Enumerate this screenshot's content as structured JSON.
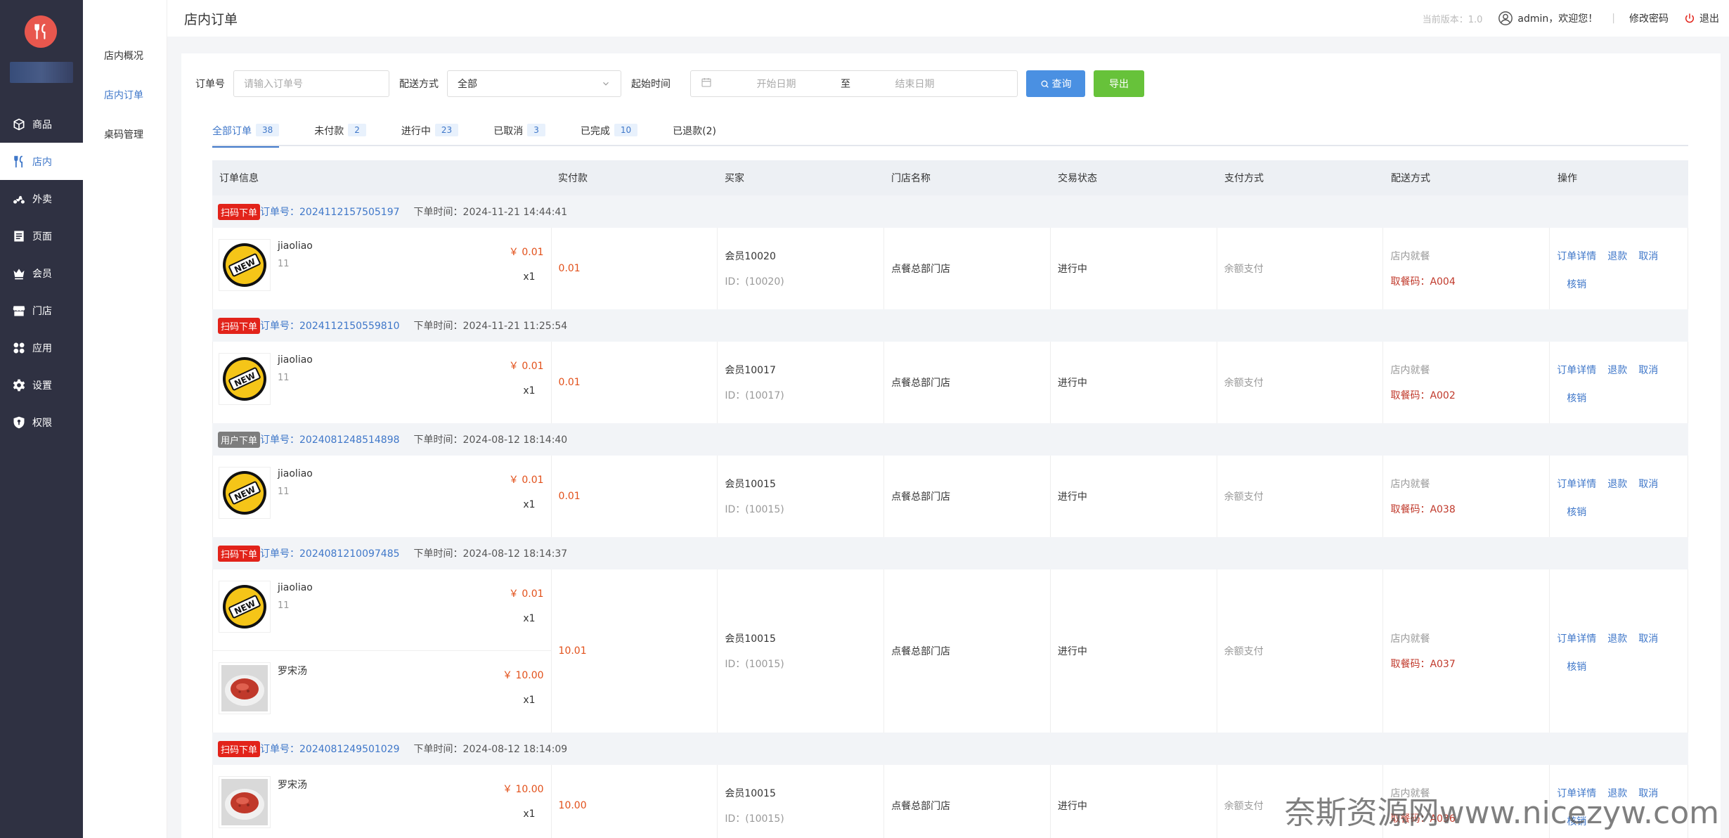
{
  "sidebar": {
    "items": [
      {
        "label": "商品",
        "icon": "box-icon"
      },
      {
        "label": "店内",
        "icon": "cutlery-icon"
      },
      {
        "label": "外卖",
        "icon": "scooter-icon"
      },
      {
        "label": "页面",
        "icon": "page-icon"
      },
      {
        "label": "会员",
        "icon": "crown-icon"
      },
      {
        "label": "门店",
        "icon": "store-icon"
      },
      {
        "label": "应用",
        "icon": "apps-icon"
      },
      {
        "label": "设置",
        "icon": "gear-icon"
      },
      {
        "label": "权限",
        "icon": "shield-icon"
      }
    ],
    "active_index": 1
  },
  "subnav": {
    "items": [
      "店内概况",
      "店内订单",
      "桌码管理"
    ],
    "active_index": 1
  },
  "header": {
    "title": "店内订单",
    "version": "当前版本：1.0",
    "welcome": "admin，欢迎您！",
    "sep": "|",
    "change_password": "修改密码",
    "logout": "退出"
  },
  "filters": {
    "order_no_label": "订单号",
    "order_no_placeholder": "请输入订单号",
    "delivery_label": "配送方式",
    "delivery_value": "全部",
    "start_time_label": "起始时间",
    "start_placeholder": "开始日期",
    "range_sep": "至",
    "end_placeholder": "结束日期",
    "query_label": "查询",
    "export_label": "导出"
  },
  "tabs": [
    {
      "label": "全部订单",
      "count": "38"
    },
    {
      "label": "未付款",
      "count": "2"
    },
    {
      "label": "进行中",
      "count": "23"
    },
    {
      "label": "已取消",
      "count": "3"
    },
    {
      "label": "已完成",
      "count": "10"
    },
    {
      "label": "已退款(2)",
      "count": ""
    }
  ],
  "table": {
    "columns": [
      "订单信息",
      "实付款",
      "买家",
      "门店名称",
      "交易状态",
      "支付方式",
      "配送方式",
      "操作"
    ],
    "orders": [
      {
        "tag": "扫码下单",
        "tag_color": "#e2231a",
        "order_no": "订单号：2024112157505197",
        "time": "下单时间：2024-11-21 14:44:41",
        "products": [
          {
            "name": "jiaoliao",
            "spec": "11",
            "price": "￥ 0.01",
            "qty": "x1",
            "thumb": "new-badge"
          }
        ],
        "paid": "0.01",
        "buyer": "会员10020",
        "buyer_id": "ID：(10020)",
        "store": "点餐总部门店",
        "status": "进行中",
        "pay_method": "余额支付",
        "delivery": "店内就餐",
        "pickup": "取餐码：A004",
        "ops": [
          "订单详情",
          "退款",
          "取消",
          "核销"
        ]
      },
      {
        "tag": "扫码下单",
        "tag_color": "#e2231a",
        "order_no": "订单号：2024112150559810",
        "time": "下单时间：2024-11-21 11:25:54",
        "products": [
          {
            "name": "jiaoliao",
            "spec": "11",
            "price": "￥ 0.01",
            "qty": "x1",
            "thumb": "new-badge"
          }
        ],
        "paid": "0.01",
        "buyer": "会员10017",
        "buyer_id": "ID：(10017)",
        "store": "点餐总部门店",
        "status": "进行中",
        "pay_method": "余额支付",
        "delivery": "店内就餐",
        "pickup": "取餐码：A002",
        "ops": [
          "订单详情",
          "退款",
          "取消",
          "核销"
        ]
      },
      {
        "tag": "用户下单",
        "tag_color": "#7d7d7d",
        "order_no": "订单号：2024081248514898",
        "time": "下单时间：2024-08-12 18:14:40",
        "products": [
          {
            "name": "jiaoliao",
            "spec": "11",
            "price": "￥ 0.01",
            "qty": "x1",
            "thumb": "new-badge"
          }
        ],
        "paid": "0.01",
        "buyer": "会员10015",
        "buyer_id": "ID：(10015)",
        "store": "点餐总部门店",
        "status": "进行中",
        "pay_method": "余额支付",
        "delivery": "店内就餐",
        "pickup": "取餐码：A038",
        "ops": [
          "订单详情",
          "退款",
          "取消",
          "核销"
        ]
      },
      {
        "tag": "扫码下单",
        "tag_color": "#e2231a",
        "order_no": "订单号：2024081210097485",
        "time": "下单时间：2024-08-12 18:14:37",
        "products": [
          {
            "name": "jiaoliao",
            "spec": "11",
            "price": "￥ 0.01",
            "qty": "x1",
            "thumb": "new-badge"
          },
          {
            "name": "罗宋汤",
            "spec": "",
            "price": "￥ 10.00",
            "qty": "x1",
            "thumb": "soup"
          }
        ],
        "paid": "10.01",
        "buyer": "会员10015",
        "buyer_id": "ID：(10015)",
        "store": "点餐总部门店",
        "status": "进行中",
        "pay_method": "余额支付",
        "delivery": "店内就餐",
        "pickup": "取餐码：A037",
        "ops": [
          "订单详情",
          "退款",
          "取消",
          "核销"
        ]
      },
      {
        "tag": "扫码下单",
        "tag_color": "#e2231a",
        "order_no": "订单号：2024081249501029",
        "time": "下单时间：2024-08-12 18:14:09",
        "products": [
          {
            "name": "罗宋汤",
            "spec": "",
            "price": "￥ 10.00",
            "qty": "x1",
            "thumb": "soup"
          }
        ],
        "paid": "10.00",
        "buyer": "会员10015",
        "buyer_id": "ID：(10015)",
        "store": "点餐总部门店",
        "status": "进行中",
        "pay_method": "余额支付",
        "delivery": "店内就餐",
        "pickup": "取餐码：A036",
        "ops": [
          "订单详情",
          "退款",
          "取消",
          "核销"
        ]
      }
    ]
  },
  "watermark": "奈斯资源网www.nicezyw.com",
  "colors": {
    "accent": "#3f77c9",
    "sidebar": "#2f3142",
    "price": "#e2501a",
    "export": "#67c23a",
    "query": "#4a90e2"
  }
}
